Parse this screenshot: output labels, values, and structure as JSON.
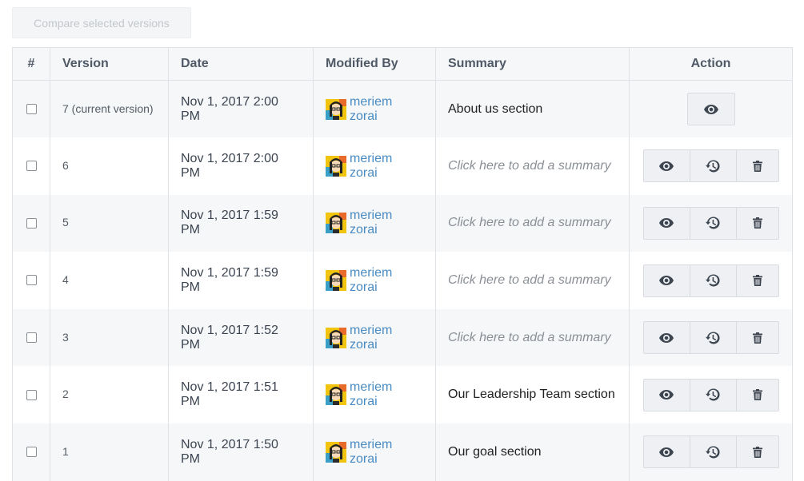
{
  "toolbar": {
    "compare_label": "Compare selected versions"
  },
  "table": {
    "headers": {
      "num": "#",
      "version": "Version",
      "date": "Date",
      "modified_by": "Modified By",
      "summary": "Summary",
      "action": "Action"
    },
    "rows": [
      {
        "version": "7 (current version)",
        "date": "Nov 1, 2017 2:00 PM",
        "user": "meriem zorai",
        "summary": "About us section",
        "summary_is_placeholder": false,
        "actions": [
          "eye-icon"
        ]
      },
      {
        "version": "6",
        "date": "Nov 1, 2017 2:00 PM",
        "user": "meriem zorai",
        "summary": "Click here to add a summary",
        "summary_is_placeholder": true,
        "actions": [
          "eye-icon",
          "restore-icon",
          "trash-icon"
        ]
      },
      {
        "version": "5",
        "date": "Nov 1, 2017 1:59 PM",
        "user": "meriem zorai",
        "summary": "Click here to add a summary",
        "summary_is_placeholder": true,
        "actions": [
          "eye-icon",
          "restore-icon",
          "trash-icon"
        ]
      },
      {
        "version": "4",
        "date": "Nov 1, 2017 1:59 PM",
        "user": "meriem zorai",
        "summary": "Click here to add a summary",
        "summary_is_placeholder": true,
        "actions": [
          "eye-icon",
          "restore-icon",
          "trash-icon"
        ]
      },
      {
        "version": "3",
        "date": "Nov 1, 2017 1:52 PM",
        "user": "meriem zorai",
        "summary": "Click here to add a summary",
        "summary_is_placeholder": true,
        "actions": [
          "eye-icon",
          "restore-icon",
          "trash-icon"
        ]
      },
      {
        "version": "2",
        "date": "Nov 1, 2017 1:51 PM",
        "user": "meriem zorai",
        "summary": "Our Leadership Team section",
        "summary_is_placeholder": false,
        "actions": [
          "eye-icon",
          "restore-icon",
          "trash-icon"
        ]
      },
      {
        "version": "1",
        "date": "Nov 1, 2017 1:50 PM",
        "user": "meriem zorai",
        "summary": "Our goal section",
        "summary_is_placeholder": false,
        "actions": [
          "eye-icon",
          "restore-icon",
          "trash-icon"
        ]
      }
    ]
  },
  "colors": {
    "link": "#4a8bc2",
    "header_bg": "#f5f7f9",
    "border": "#dfe3e8",
    "icon": "#3d4650"
  }
}
